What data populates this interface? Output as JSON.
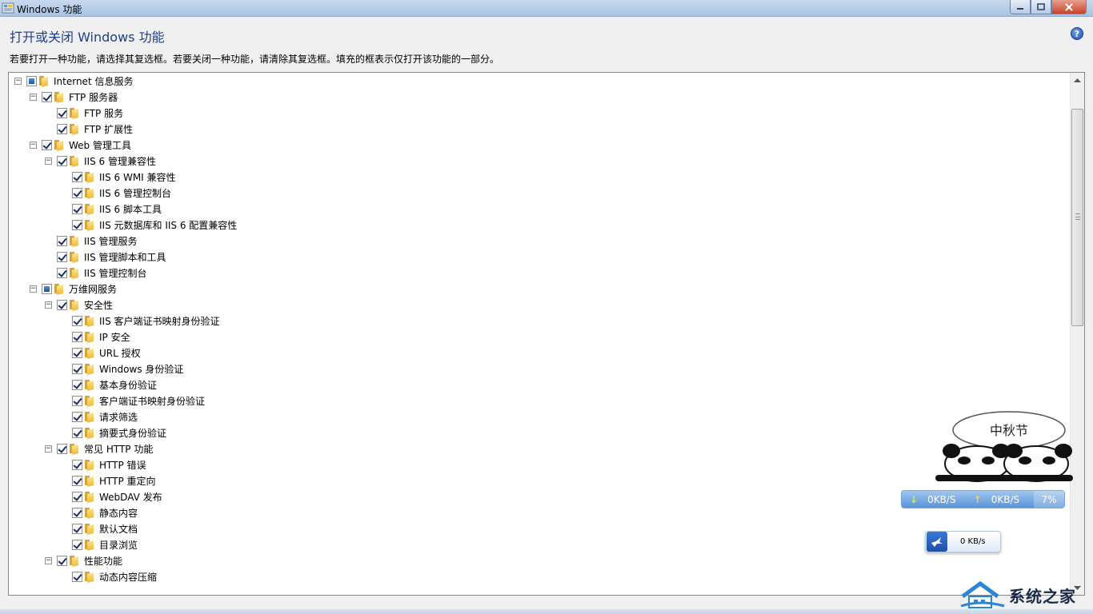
{
  "window": {
    "title": "Windows 功能",
    "heading": "打开或关闭 Windows 功能",
    "description": "若要打开一种功能，请选择其复选框。若要关闭一种功能，请清除其复选框。填充的框表示仅打开该功能的一部分。",
    "help_glyph": "?"
  },
  "tree": {
    "items": [
      {
        "label": "Internet 信息服务",
        "level": 0,
        "state": "partial",
        "expander": "minus"
      },
      {
        "label": "FTP 服务器",
        "level": 1,
        "state": "checked",
        "expander": "minus"
      },
      {
        "label": "FTP 服务",
        "level": 2,
        "state": "checked",
        "expander": "none"
      },
      {
        "label": "FTP 扩展性",
        "level": 2,
        "state": "checked",
        "expander": "none"
      },
      {
        "label": "Web 管理工具",
        "level": 1,
        "state": "checked",
        "expander": "minus"
      },
      {
        "label": "IIS 6 管理兼容性",
        "level": 2,
        "state": "checked",
        "expander": "minus"
      },
      {
        "label": "IIS 6 WMI 兼容性",
        "level": 3,
        "state": "checked",
        "expander": "none"
      },
      {
        "label": "IIS 6 管理控制台",
        "level": 3,
        "state": "checked",
        "expander": "none"
      },
      {
        "label": "IIS 6 脚本工具",
        "level": 3,
        "state": "checked",
        "expander": "none"
      },
      {
        "label": "IIS 元数据库和 IIS 6 配置兼容性",
        "level": 3,
        "state": "checked",
        "expander": "none"
      },
      {
        "label": "IIS 管理服务",
        "level": 2,
        "state": "checked",
        "expander": "none"
      },
      {
        "label": "IIS 管理脚本和工具",
        "level": 2,
        "state": "checked",
        "expander": "none"
      },
      {
        "label": "IIS 管理控制台",
        "level": 2,
        "state": "checked",
        "expander": "none"
      },
      {
        "label": "万维网服务",
        "level": 1,
        "state": "partial",
        "expander": "minus"
      },
      {
        "label": "安全性",
        "level": 2,
        "state": "checked",
        "expander": "minus"
      },
      {
        "label": "IIS 客户端证书映射身份验证",
        "level": 3,
        "state": "checked",
        "expander": "none"
      },
      {
        "label": "IP 安全",
        "level": 3,
        "state": "checked",
        "expander": "none"
      },
      {
        "label": "URL 授权",
        "level": 3,
        "state": "checked",
        "expander": "none"
      },
      {
        "label": "Windows 身份验证",
        "level": 3,
        "state": "checked",
        "expander": "none"
      },
      {
        "label": "基本身份验证",
        "level": 3,
        "state": "checked",
        "expander": "none"
      },
      {
        "label": "客户端证书映射身份验证",
        "level": 3,
        "state": "checked",
        "expander": "none"
      },
      {
        "label": "请求筛选",
        "level": 3,
        "state": "checked",
        "expander": "none"
      },
      {
        "label": "摘要式身份验证",
        "level": 3,
        "state": "checked",
        "expander": "none"
      },
      {
        "label": "常见 HTTP 功能",
        "level": 2,
        "state": "checked",
        "expander": "minus"
      },
      {
        "label": "HTTP 错误",
        "level": 3,
        "state": "checked",
        "expander": "none"
      },
      {
        "label": "HTTP 重定向",
        "level": 3,
        "state": "checked",
        "expander": "none"
      },
      {
        "label": "WebDAV 发布",
        "level": 3,
        "state": "checked",
        "expander": "none"
      },
      {
        "label": "静态内容",
        "level": 3,
        "state": "checked",
        "expander": "none"
      },
      {
        "label": "默认文档",
        "level": 3,
        "state": "checked",
        "expander": "none"
      },
      {
        "label": "目录浏览",
        "level": 3,
        "state": "checked",
        "expander": "none"
      },
      {
        "label": "性能功能",
        "level": 2,
        "state": "checked",
        "expander": "minus"
      },
      {
        "label": "动态内容压缩",
        "level": 3,
        "state": "checked",
        "expander": "none"
      }
    ]
  },
  "speed_widget": {
    "download": "0KB/S",
    "upload": "0KB/S",
    "cpu": "7%"
  },
  "net_widget": {
    "speed": "0 KB/s"
  },
  "watermark": {
    "text": "系统之家"
  },
  "mascot": {
    "bubble_text": "中秋节"
  },
  "colors": {
    "heading": "#1e3f8f",
    "speed_widget_bg": "#5a93d8",
    "partial_fill": "#1d4f98"
  }
}
